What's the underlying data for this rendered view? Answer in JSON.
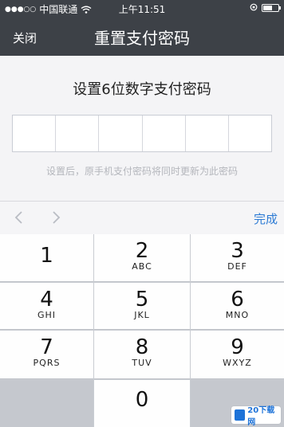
{
  "status_bar": {
    "signal_dots": "●●●○○",
    "carrier": "中国联通",
    "time": "上午11:51",
    "battery_level": 0.6
  },
  "nav": {
    "close_label": "关闭",
    "title": "重置支付密码"
  },
  "content": {
    "prompt": "设置6位数字支付密码",
    "digit_count": 6,
    "hint": "设置后，原手机支付密码将同时更新为此密码"
  },
  "toolbar": {
    "done_label": "完成"
  },
  "keypad": {
    "keys": [
      {
        "num": "1",
        "letters": ""
      },
      {
        "num": "2",
        "letters": "ABC"
      },
      {
        "num": "3",
        "letters": "DEF"
      },
      {
        "num": "4",
        "letters": "GHI"
      },
      {
        "num": "5",
        "letters": "JKL"
      },
      {
        "num": "6",
        "letters": "MNO"
      },
      {
        "num": "7",
        "letters": "PQRS"
      },
      {
        "num": "8",
        "letters": "TUV"
      },
      {
        "num": "9",
        "letters": "WXYZ"
      },
      {
        "num": "0",
        "letters": ""
      }
    ]
  },
  "watermark": {
    "text": "20下载网"
  },
  "colors": {
    "nav_bg": "#3d4147",
    "accent": "#2d7bd4"
  }
}
